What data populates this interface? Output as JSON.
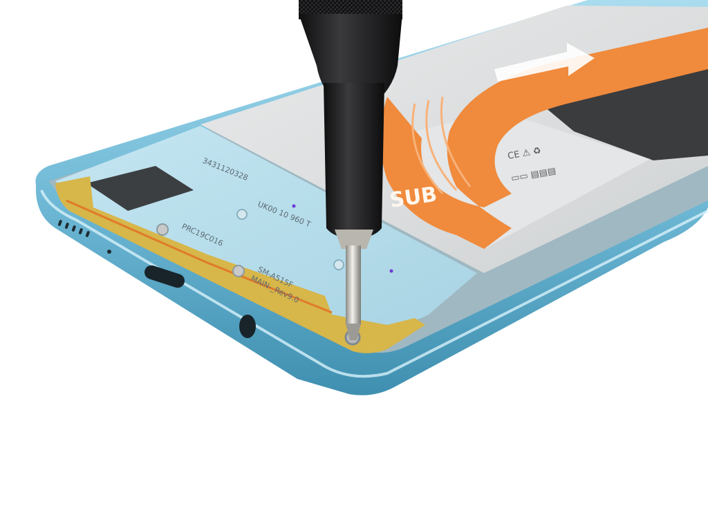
{
  "photo": {
    "flex_cable_label": "SUB",
    "pcb_label_serial": "UK00 10 960 T",
    "pcb_label_model": "SM-A515F",
    "pcb_label_board": "MAIN-_Rev9.0",
    "pcb_label_top": "3431120328",
    "pcb_label_left": "PRC19C016",
    "colors": {
      "frame": "#7cc3dd",
      "frame_dark": "#4d9ab9",
      "board": "#b9dde9",
      "flex": "#f08a3c",
      "battery": "#d9dbdc",
      "driver": "#1d1d1f"
    }
  }
}
